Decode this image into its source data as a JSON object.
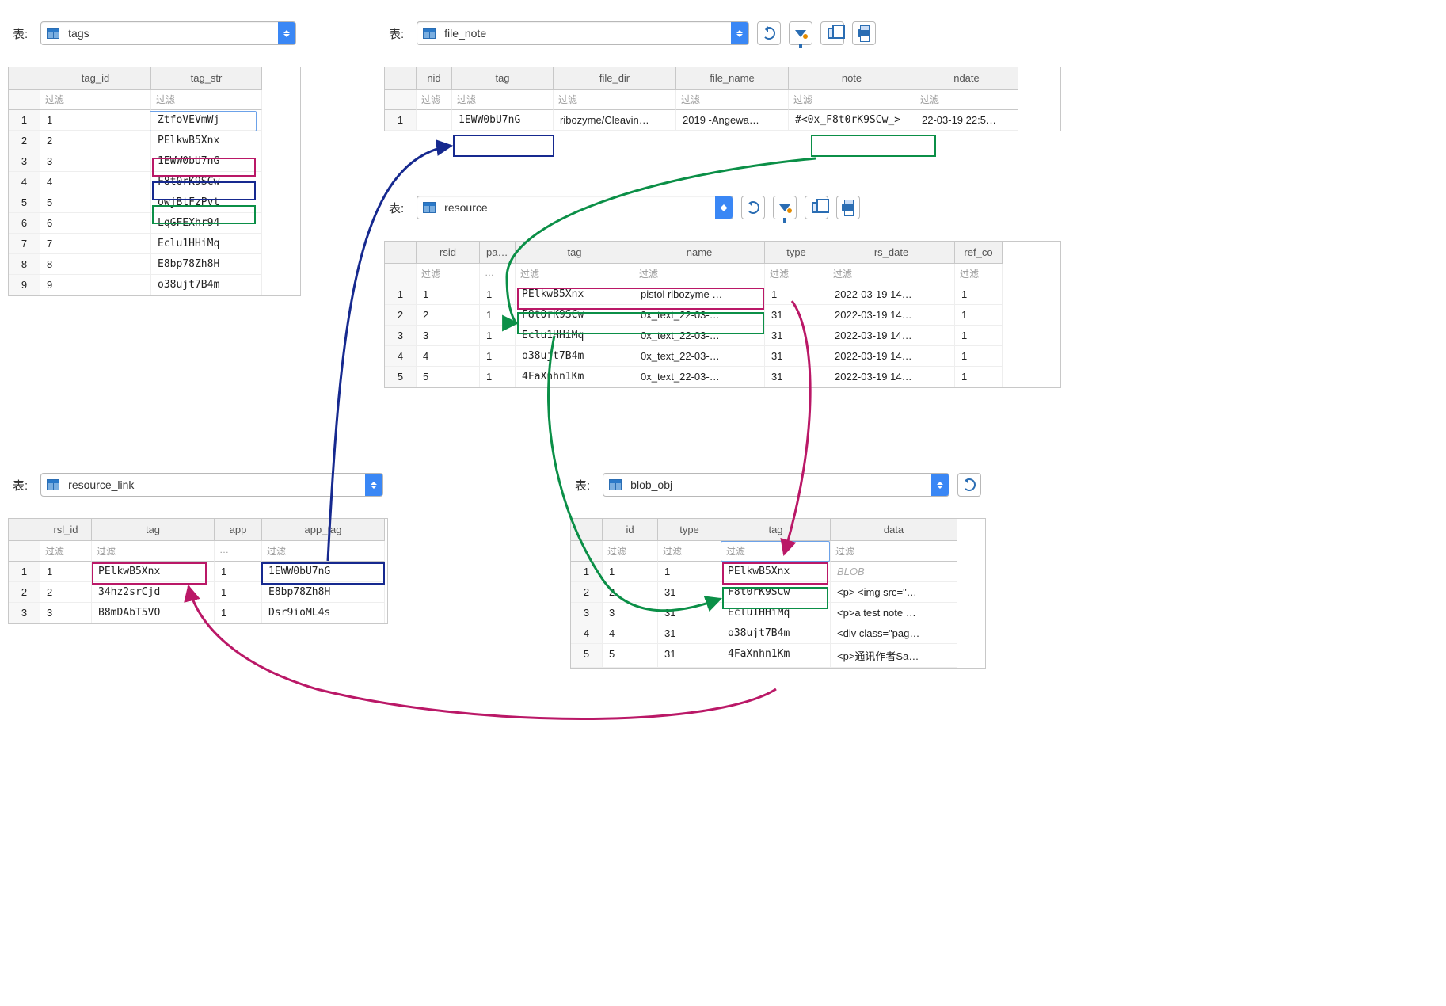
{
  "labels": {
    "table_prefix": "表:",
    "filter": "过滤",
    "filter_ellipsis": "…"
  },
  "icons": {
    "table": "table-icon",
    "refresh": "refresh-icon",
    "funnel": "filter-icon",
    "copy": "copy-icon",
    "print": "print-icon",
    "dropdown": "dropdown-icon"
  },
  "tables": {
    "tags": {
      "name": "tags",
      "columns": [
        "tag_id",
        "tag_str"
      ],
      "rows": [
        [
          "1",
          "ZtfoVEVmWj"
        ],
        [
          "2",
          "PElkwB5Xnx"
        ],
        [
          "3",
          "1EWW0bU7nG"
        ],
        [
          "4",
          "F8t0rK9SCw"
        ],
        [
          "5",
          "owjBtFzPvt"
        ],
        [
          "6",
          "LqGFEXhr94"
        ],
        [
          "7",
          "Eclu1HHiMq"
        ],
        [
          "8",
          "E8bp78Zh8H"
        ],
        [
          "9",
          "o38ujt7B4m"
        ]
      ]
    },
    "file_note": {
      "name": "file_note",
      "columns": [
        "nid",
        "tag",
        "file_dir",
        "file_name",
        "note",
        "ndate"
      ],
      "rows": [
        [
          "",
          "1EWW0bU7nG",
          "ribozyme/Cleavin…",
          "2019 -Angewa…",
          "#<0x_F8t0rK9SCw_>",
          "22-03-19 22:5…"
        ]
      ]
    },
    "resource": {
      "name": "resource",
      "columns": [
        "rsid",
        "page",
        "tag",
        "name",
        "type",
        "rs_date",
        "ref_co"
      ],
      "rows": [
        [
          "1",
          "1",
          "PElkwB5Xnx",
          "pistol ribozyme …",
          "1",
          "2022-03-19 14…",
          "1"
        ],
        [
          "2",
          "1",
          "F8t0rK9SCw",
          "0x_text_22-03-…",
          "31",
          "2022-03-19 14…",
          "1"
        ],
        [
          "3",
          "1",
          "Eclu1HHiMq",
          "0x_text_22-03-…",
          "31",
          "2022-03-19 14…",
          "1"
        ],
        [
          "4",
          "1",
          "o38ujt7B4m",
          "0x_text_22-03-…",
          "31",
          "2022-03-19 14…",
          "1"
        ],
        [
          "5",
          "1",
          "4FaXnhn1Km",
          "0x_text_22-03-…",
          "31",
          "2022-03-19 14…",
          "1"
        ]
      ]
    },
    "resource_link": {
      "name": "resource_link",
      "columns": [
        "rsl_id",
        "tag",
        "app",
        "app_tag"
      ],
      "rows": [
        [
          "1",
          "PElkwB5Xnx",
          "1",
          "1EWW0bU7nG"
        ],
        [
          "2",
          "34hz2srCjd",
          "1",
          "E8bp78Zh8H"
        ],
        [
          "3",
          "B8mDAbT5VO",
          "1",
          "Dsr9ioML4s"
        ]
      ]
    },
    "blob_obj": {
      "name": "blob_obj",
      "columns": [
        "id",
        "type",
        "tag",
        "data"
      ],
      "blob_label": "BLOB",
      "rows": [
        [
          "1",
          "1",
          "PElkwB5Xnx",
          "BLOB"
        ],
        [
          "2",
          "31",
          "F8t0rK9SCw",
          "<p> <img src=\"…"
        ],
        [
          "3",
          "31",
          "Eclu1HHiMq",
          "<p>a test note …"
        ],
        [
          "4",
          "31",
          "o38ujt7B4m",
          "<div class=\"pag…"
        ],
        [
          "5",
          "31",
          "4FaXnhn1Km",
          "<p>通讯作者Sa…"
        ]
      ]
    }
  },
  "highlights": {
    "magenta": "#ba1867",
    "navy": "#16298f",
    "green": "#0b8f47"
  }
}
